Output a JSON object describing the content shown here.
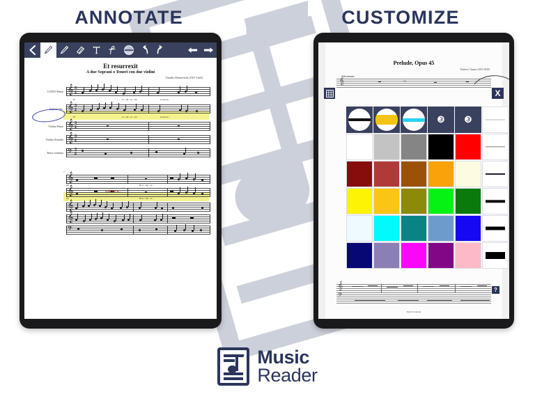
{
  "brand": {
    "name_line1": "Music",
    "name_line2": "Reader",
    "logo_icon": "sheet-music-note-icon",
    "accent_color": "#2b355b"
  },
  "headings": {
    "left": "ANNOTATE",
    "right": "CUSTOMIZE"
  },
  "left_panel": {
    "device": "tablet",
    "toolbar": {
      "items": [
        {
          "name": "back-chevron-icon",
          "label": "Back",
          "active": false
        },
        {
          "name": "pencil-icon",
          "label": "Pencil",
          "active": true
        },
        {
          "name": "highlighter-icon",
          "label": "Highlighter",
          "active": false
        },
        {
          "name": "eraser-icon",
          "label": "Eraser",
          "active": false
        },
        {
          "name": "text-tool-icon",
          "label": "Text",
          "active": false
        },
        {
          "name": "slur-tool-icon",
          "label": "Slur",
          "active": false
        },
        {
          "name": "color-circle-icon",
          "label": "Color",
          "active": false
        },
        {
          "name": "undo-icon",
          "label": "Undo",
          "active": false
        },
        {
          "name": "redo-icon",
          "label": "Redo",
          "active": false
        },
        {
          "name": "prev-page-arrow-icon",
          "label": "Previous page",
          "active": false
        },
        {
          "name": "next-page-arrow-icon",
          "label": "Next page",
          "active": false
        }
      ]
    },
    "score": {
      "title": "Et resurrexit",
      "subtitle": "A due Soprani o Tenori con due violini",
      "composer": "Claudio Monteverdi (1567-1643)",
      "time_signature": "3/2",
      "staff_labels": [
        "CANTO Primo",
        "Soprano Sec.",
        "Violino Primo",
        "Violino Secondo",
        "Basso continuo"
      ],
      "lyrics_system1": [
        {
          "text": "Et",
          "staff": 1
        },
        {
          "text": "re - sur - re - xit",
          "staff": 1
        },
        {
          "text": "re-sur-re -",
          "staff": 1
        },
        {
          "text": "Et",
          "staff": 2
        },
        {
          "text": "re - sur - re - xit",
          "staff": 2
        },
        {
          "text": "re-sur-re -",
          "staff": 2
        }
      ],
      "lyrics_system2": [
        {
          "text": "xit",
          "staff": 1
        },
        {
          "text": "&   re - sur - re -",
          "staff": 1
        },
        {
          "text": "xit",
          "staff": 2
        },
        {
          "text": "&   re - sur - re -",
          "staff": 2
        }
      ],
      "page_number": "2"
    },
    "annotations": [
      {
        "type": "circle",
        "color": "#3a3fb0",
        "target": "Soprano Sec."
      },
      {
        "type": "highlight",
        "color": "#f2f07a",
        "target": "Soprano Sec. staff"
      },
      {
        "type": "text",
        "color": "#c0392b",
        "text": "wait for it..."
      }
    ]
  },
  "right_panel": {
    "device": "tablet",
    "score": {
      "title": "Prelude, Opus 45",
      "composer": "Frederic Chopin (1810-1849)",
      "tempo": "Sostenuto",
      "footer": "Public Domain"
    },
    "overlay": {
      "grid_icon": "grid-icon",
      "close_icon": "close-x-icon",
      "close_label": "X",
      "help_icon": "help-question-icon",
      "help_label": "?"
    },
    "palette": {
      "rows": [
        {
          "kind": "tools",
          "cells": [
            {
              "type": "preview-circle",
              "name": "pen-preview",
              "stroke": "#111111",
              "thickness": 4
            },
            {
              "type": "preview-circle",
              "name": "highlighter-preview",
              "stroke": "#f4c413",
              "thickness": 14
            },
            {
              "type": "preview-circle",
              "name": "thin-highlighter-preview",
              "stroke": "#25d3ef",
              "thickness": 5
            },
            {
              "type": "tool",
              "name": "stamp-tool-1",
              "glyph": "❸"
            },
            {
              "type": "tool",
              "name": "stamp-tool-2",
              "glyph": "❸"
            },
            {
              "type": "width",
              "name": "width-hairline",
              "stroke": "#b8b8b8",
              "thickness": 1
            }
          ]
        },
        {
          "kind": "colors",
          "cells": [
            {
              "type": "color",
              "name": "white",
              "hex": "#ffffff"
            },
            {
              "type": "color",
              "name": "light-gray",
              "hex": "#c3c3c3"
            },
            {
              "type": "color",
              "name": "gray",
              "hex": "#858585"
            },
            {
              "type": "color",
              "name": "black",
              "hex": "#000000"
            },
            {
              "type": "color",
              "name": "red",
              "hex": "#fe0000"
            },
            {
              "type": "width",
              "name": "width-1",
              "stroke": "#8a8275",
              "thickness": 1.4
            }
          ]
        },
        {
          "kind": "colors",
          "cells": [
            {
              "type": "color",
              "name": "dark-red",
              "hex": "#870d0d"
            },
            {
              "type": "color",
              "name": "brick-red",
              "hex": "#b03a38"
            },
            {
              "type": "color",
              "name": "brown",
              "hex": "#9c5206"
            },
            {
              "type": "color",
              "name": "orange",
              "hex": "#f9a20a"
            },
            {
              "type": "color",
              "name": "ivory",
              "hex": "#fdfbe0"
            },
            {
              "type": "width",
              "name": "width-2",
              "stroke": "#1c1c36",
              "thickness": 2
            }
          ]
        },
        {
          "kind": "colors",
          "cells": [
            {
              "type": "color",
              "name": "yellow",
              "hex": "#fcf402"
            },
            {
              "type": "color",
              "name": "gold",
              "hex": "#fbc515"
            },
            {
              "type": "color",
              "name": "olive",
              "hex": "#8c8a06"
            },
            {
              "type": "color",
              "name": "bright-green",
              "hex": "#06f215"
            },
            {
              "type": "color",
              "name": "dark-green",
              "hex": "#0a7a0c"
            },
            {
              "type": "width",
              "name": "width-3",
              "stroke": "#111111",
              "thickness": 3.5
            }
          ]
        },
        {
          "kind": "colors",
          "cells": [
            {
              "type": "color",
              "name": "azure",
              "hex": "#eefaff"
            },
            {
              "type": "color",
              "name": "cyan",
              "hex": "#03f9fb"
            },
            {
              "type": "color",
              "name": "teal",
              "hex": "#0b8384"
            },
            {
              "type": "color",
              "name": "steel-blue",
              "hex": "#6d9ccb"
            },
            {
              "type": "color",
              "name": "blue",
              "hex": "#1708f4"
            },
            {
              "type": "width",
              "name": "width-4",
              "stroke": "#000000",
              "thickness": 5
            }
          ]
        },
        {
          "kind": "colors",
          "cells": [
            {
              "type": "color",
              "name": "navy",
              "hex": "#080874"
            },
            {
              "type": "color",
              "name": "medium-purple",
              "hex": "#8c7fb6"
            },
            {
              "type": "color",
              "name": "magenta",
              "hex": "#fa06fa"
            },
            {
              "type": "color",
              "name": "purple",
              "hex": "#820786"
            },
            {
              "type": "color",
              "name": "pink",
              "hex": "#fcbac6"
            },
            {
              "type": "width",
              "name": "width-5",
              "stroke": "#000000",
              "thickness": 10
            }
          ]
        }
      ]
    }
  }
}
